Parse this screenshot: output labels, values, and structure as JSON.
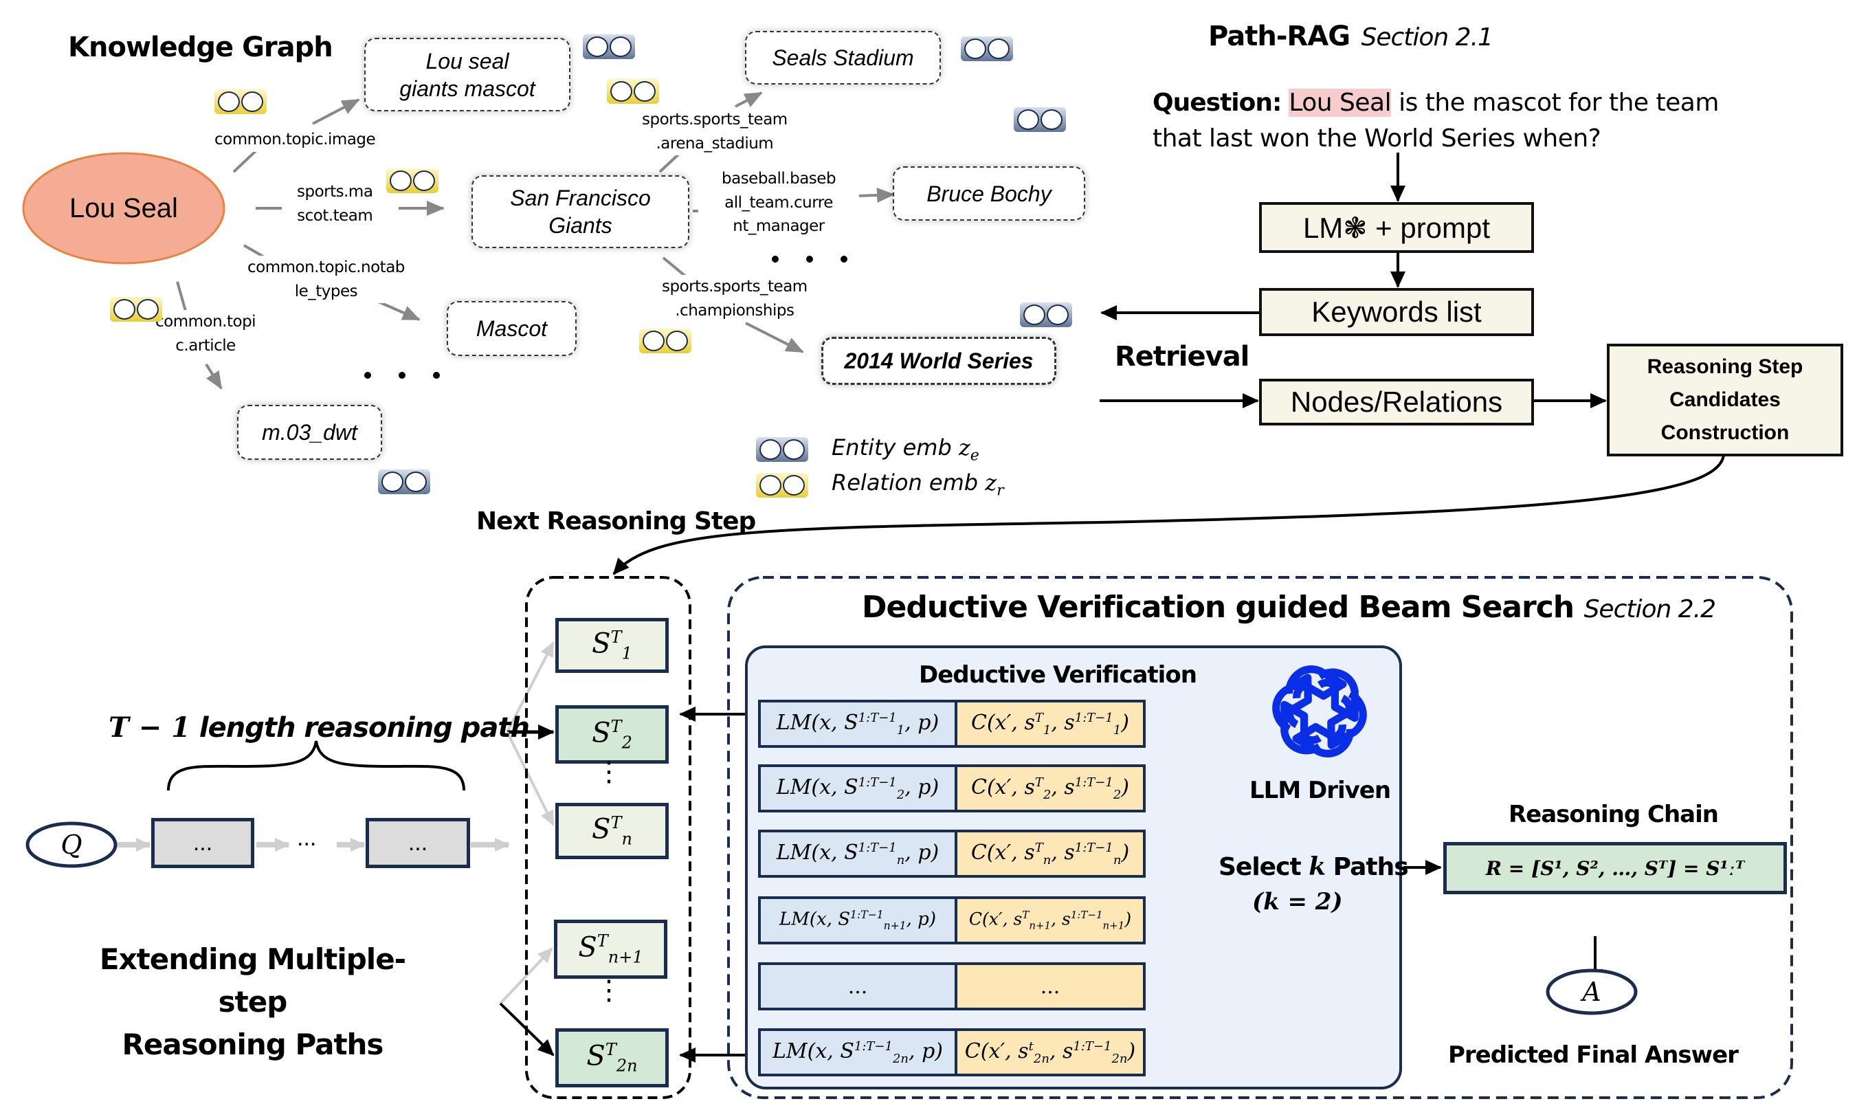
{
  "knowledge_graph": {
    "title": "Knowledge Graph",
    "center_entity": "Lou Seal",
    "entities": {
      "lou_seal_mascot": [
        "Lou seal",
        "giants mascot"
      ],
      "seals_stadium": "Seals Stadium",
      "sf_giants": [
        "San Francisco",
        "Giants"
      ],
      "bruce_bochy": "Bruce Bochy",
      "mascot": "Mascot",
      "world_series": "2014 World Series",
      "m03_dwt": "m.03_dwt"
    },
    "relations": {
      "image": "common.topic.image",
      "mascot_team": [
        "sports.ma",
        "scot.team"
      ],
      "notable_types": [
        "common.topic.notab",
        "le_types"
      ],
      "article": [
        "common.topi",
        "c.article"
      ],
      "arena_stadium": [
        "sports.sports_team",
        ".arena_stadium"
      ],
      "current_manager": [
        "baseball.baseb",
        "all_team.curre",
        "nt_manager"
      ],
      "championships": [
        "sports.sports_team",
        ".championships"
      ]
    },
    "ellipsis": ". . .",
    "legend": {
      "entity": "Entity emb",
      "entity_symbol": "z",
      "entity_sub": "e",
      "relation": "Relation emb",
      "relation_symbol": "z",
      "relation_sub": "r"
    }
  },
  "path_rag": {
    "title": "Path-RAG",
    "section": "Section 2.1",
    "question_label": "Question:",
    "question_highlight": "Lou Seal",
    "question_rest_line1": " is the mascot for the team",
    "question_line2": "that last won the World Series when?",
    "lm_box": "LM❃ + prompt",
    "keywords_box": "Keywords list",
    "retrieval_label": "Retrieval",
    "nodes_box": "Nodes/Relations",
    "candidates_box": [
      "Reasoning Step",
      "Candidates",
      "Construction"
    ]
  },
  "extending": {
    "next_step_label": "Next Reasoning Step",
    "path_label_math": "T − 1",
    "path_label_text": " length reasoning path",
    "q_node": "Q",
    "chain_dots": [
      "...",
      "...",
      "..."
    ],
    "title": [
      "Extending Multiple-step",
      "Reasoning Paths"
    ],
    "candidates": [
      {
        "base": "S",
        "sup": "T",
        "sub": "1",
        "selected": false
      },
      {
        "base": "S",
        "sup": "T",
        "sub": "2",
        "selected": true
      },
      {
        "base": "S",
        "sup": "T",
        "sub": "n",
        "selected": false
      },
      {
        "base": "S",
        "sup": "T",
        "sub": "n+1",
        "selected": false
      },
      {
        "base": "S",
        "sup": "T",
        "sub": "2n",
        "selected": true
      }
    ],
    "vdots": "⋮"
  },
  "beam_search": {
    "title": "Deductive Verification guided Beam Search",
    "section": "Section 2.2",
    "dv_title": "Deductive Verification",
    "llm_label": "LLM Driven",
    "select_label_pre": "Select ",
    "select_label_k": "k",
    "select_label_post": " Paths",
    "select_param": "(k = 2)",
    "rows": [
      {
        "lm_sub": "1",
        "c_sup": "T",
        "c_sub": "1",
        "c_sub2": "1"
      },
      {
        "lm_sub": "2",
        "c_sup": "T",
        "c_sub": "2",
        "c_sub2": "2"
      },
      {
        "lm_sub": "n",
        "c_sup": "T",
        "c_sub": "n",
        "c_sub2": "n"
      },
      {
        "lm_sub": "n+1",
        "c_sup": "T",
        "c_sub": "n+1",
        "c_sub2": "n+1"
      },
      {
        "ellipsis": "..."
      },
      {
        "lm_sub": "2n",
        "c_sup": "t",
        "c_sub": "2n",
        "c_sub2": "2n"
      }
    ],
    "lm_prefix": "LM(x, S",
    "lm_sup": "1:T−1",
    "lm_suffix": ", p)",
    "c_prefix": "C(x′, s",
    "c_sup2": "1:T−1",
    "reasoning_chain_title": "Reasoning Chain",
    "reasoning_chain_formula": "R = [S¹, S², …, Sᵀ] = S¹ːᵀ",
    "answer_node": "A",
    "answer_label": "Predicted Final Answer"
  },
  "colors": {
    "lou_seal_fill": "#f4a98e",
    "lou_seal_stroke": "#e8843f",
    "highlight": "#f8cccc",
    "flowbox_fill": "#f6f5e8",
    "s_light": "#eef2e4",
    "s_green": "#d4e8d6",
    "lm_cell": "#dae6f3",
    "c_cell": "#fde7b6",
    "dv_panel": "#eaf1fb",
    "navy": "#1b2d4f",
    "openai_blue": "#0a2ee8"
  }
}
